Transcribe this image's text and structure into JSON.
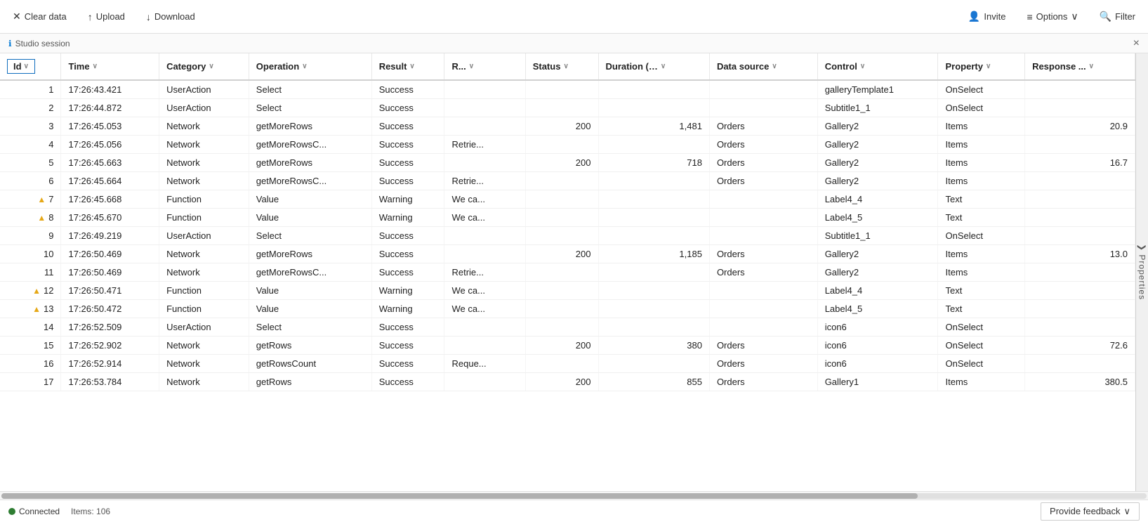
{
  "toolbar": {
    "clear_label": "Clear data",
    "upload_label": "Upload",
    "download_label": "Download",
    "invite_label": "Invite",
    "options_label": "Options",
    "filter_label": "Filter"
  },
  "session": {
    "label": "Studio session",
    "close_icon": "×"
  },
  "table": {
    "columns": [
      {
        "id": "id",
        "label": "Id",
        "sort": true
      },
      {
        "id": "time",
        "label": "Time",
        "sort": true
      },
      {
        "id": "category",
        "label": "Category",
        "sort": true
      },
      {
        "id": "operation",
        "label": "Operation",
        "sort": true
      },
      {
        "id": "result",
        "label": "Result",
        "sort": true
      },
      {
        "id": "r",
        "label": "R...",
        "sort": true
      },
      {
        "id": "status",
        "label": "Status",
        "sort": true
      },
      {
        "id": "duration",
        "label": "Duration (..…",
        "sort": true
      },
      {
        "id": "datasource",
        "label": "Data source",
        "sort": true
      },
      {
        "id": "control",
        "label": "Control",
        "sort": true
      },
      {
        "id": "property",
        "label": "Property",
        "sort": true
      },
      {
        "id": "response",
        "label": "Response ...",
        "sort": true
      }
    ],
    "rows": [
      {
        "id": 1,
        "time": "17:26:43.421",
        "category": "UserAction",
        "operation": "Select",
        "result": "Success",
        "r": "",
        "status": "",
        "duration": "",
        "datasource": "",
        "control": "galleryTemplate1",
        "property": "OnSelect",
        "response": "",
        "warning": false
      },
      {
        "id": 2,
        "time": "17:26:44.872",
        "category": "UserAction",
        "operation": "Select",
        "result": "Success",
        "r": "",
        "status": "",
        "duration": "",
        "datasource": "",
        "control": "Subtitle1_1",
        "property": "OnSelect",
        "response": "",
        "warning": false
      },
      {
        "id": 3,
        "time": "17:26:45.053",
        "category": "Network",
        "operation": "getMoreRows",
        "result": "Success",
        "r": "",
        "status": "200",
        "duration": "1,481",
        "datasource": "Orders",
        "control": "Gallery2",
        "property": "Items",
        "response": "20.9",
        "warning": false
      },
      {
        "id": 4,
        "time": "17:26:45.056",
        "category": "Network",
        "operation": "getMoreRowsC...",
        "result": "Success",
        "r": "Retrie...",
        "status": "",
        "duration": "",
        "datasource": "Orders",
        "control": "Gallery2",
        "property": "Items",
        "response": "",
        "warning": false
      },
      {
        "id": 5,
        "time": "17:26:45.663",
        "category": "Network",
        "operation": "getMoreRows",
        "result": "Success",
        "r": "",
        "status": "200",
        "duration": "718",
        "datasource": "Orders",
        "control": "Gallery2",
        "property": "Items",
        "response": "16.7",
        "warning": false
      },
      {
        "id": 6,
        "time": "17:26:45.664",
        "category": "Network",
        "operation": "getMoreRowsC...",
        "result": "Success",
        "r": "Retrie...",
        "status": "",
        "duration": "",
        "datasource": "Orders",
        "control": "Gallery2",
        "property": "Items",
        "response": "",
        "warning": false
      },
      {
        "id": 7,
        "time": "17:26:45.668",
        "category": "Function",
        "operation": "Value",
        "result": "Warning",
        "r": "We ca...",
        "status": "",
        "duration": "",
        "datasource": "",
        "control": "Label4_4",
        "property": "Text",
        "response": "",
        "warning": true
      },
      {
        "id": 8,
        "time": "17:26:45.670",
        "category": "Function",
        "operation": "Value",
        "result": "Warning",
        "r": "We ca...",
        "status": "",
        "duration": "",
        "datasource": "",
        "control": "Label4_5",
        "property": "Text",
        "response": "",
        "warning": true
      },
      {
        "id": 9,
        "time": "17:26:49.219",
        "category": "UserAction",
        "operation": "Select",
        "result": "Success",
        "r": "",
        "status": "",
        "duration": "",
        "datasource": "",
        "control": "Subtitle1_1",
        "property": "OnSelect",
        "response": "",
        "warning": false
      },
      {
        "id": 10,
        "time": "17:26:50.469",
        "category": "Network",
        "operation": "getMoreRows",
        "result": "Success",
        "r": "",
        "status": "200",
        "duration": "1,185",
        "datasource": "Orders",
        "control": "Gallery2",
        "property": "Items",
        "response": "13.0",
        "warning": false
      },
      {
        "id": 11,
        "time": "17:26:50.469",
        "category": "Network",
        "operation": "getMoreRowsC...",
        "result": "Success",
        "r": "Retrie...",
        "status": "",
        "duration": "",
        "datasource": "Orders",
        "control": "Gallery2",
        "property": "Items",
        "response": "",
        "warning": false
      },
      {
        "id": 12,
        "time": "17:26:50.471",
        "category": "Function",
        "operation": "Value",
        "result": "Warning",
        "r": "We ca...",
        "status": "",
        "duration": "",
        "datasource": "",
        "control": "Label4_4",
        "property": "Text",
        "response": "",
        "warning": true
      },
      {
        "id": 13,
        "time": "17:26:50.472",
        "category": "Function",
        "operation": "Value",
        "result": "Warning",
        "r": "We ca...",
        "status": "",
        "duration": "",
        "datasource": "",
        "control": "Label4_5",
        "property": "Text",
        "response": "",
        "warning": true
      },
      {
        "id": 14,
        "time": "17:26:52.509",
        "category": "UserAction",
        "operation": "Select",
        "result": "Success",
        "r": "",
        "status": "",
        "duration": "",
        "datasource": "",
        "control": "icon6",
        "property": "OnSelect",
        "response": "",
        "warning": false
      },
      {
        "id": 15,
        "time": "17:26:52.902",
        "category": "Network",
        "operation": "getRows",
        "result": "Success",
        "r": "",
        "status": "200",
        "duration": "380",
        "datasource": "Orders",
        "control": "icon6",
        "property": "OnSelect",
        "response": "72.6",
        "warning": false
      },
      {
        "id": 16,
        "time": "17:26:52.914",
        "category": "Network",
        "operation": "getRowsCount",
        "result": "Success",
        "r": "Reque...",
        "status": "",
        "duration": "",
        "datasource": "Orders",
        "control": "icon6",
        "property": "OnSelect",
        "response": "",
        "warning": false
      },
      {
        "id": 17,
        "time": "17:26:53.784",
        "category": "Network",
        "operation": "getRows",
        "result": "Success",
        "r": "",
        "status": "200",
        "duration": "855",
        "datasource": "Orders",
        "control": "Gallery1",
        "property": "Items",
        "response": "380.5",
        "warning": false
      }
    ]
  },
  "side_panel": {
    "label": "Properties"
  },
  "status": {
    "connected_label": "Connected",
    "items_label": "Items: 106"
  },
  "feedback": {
    "label": "Provide feedback",
    "chevron": "∨"
  }
}
